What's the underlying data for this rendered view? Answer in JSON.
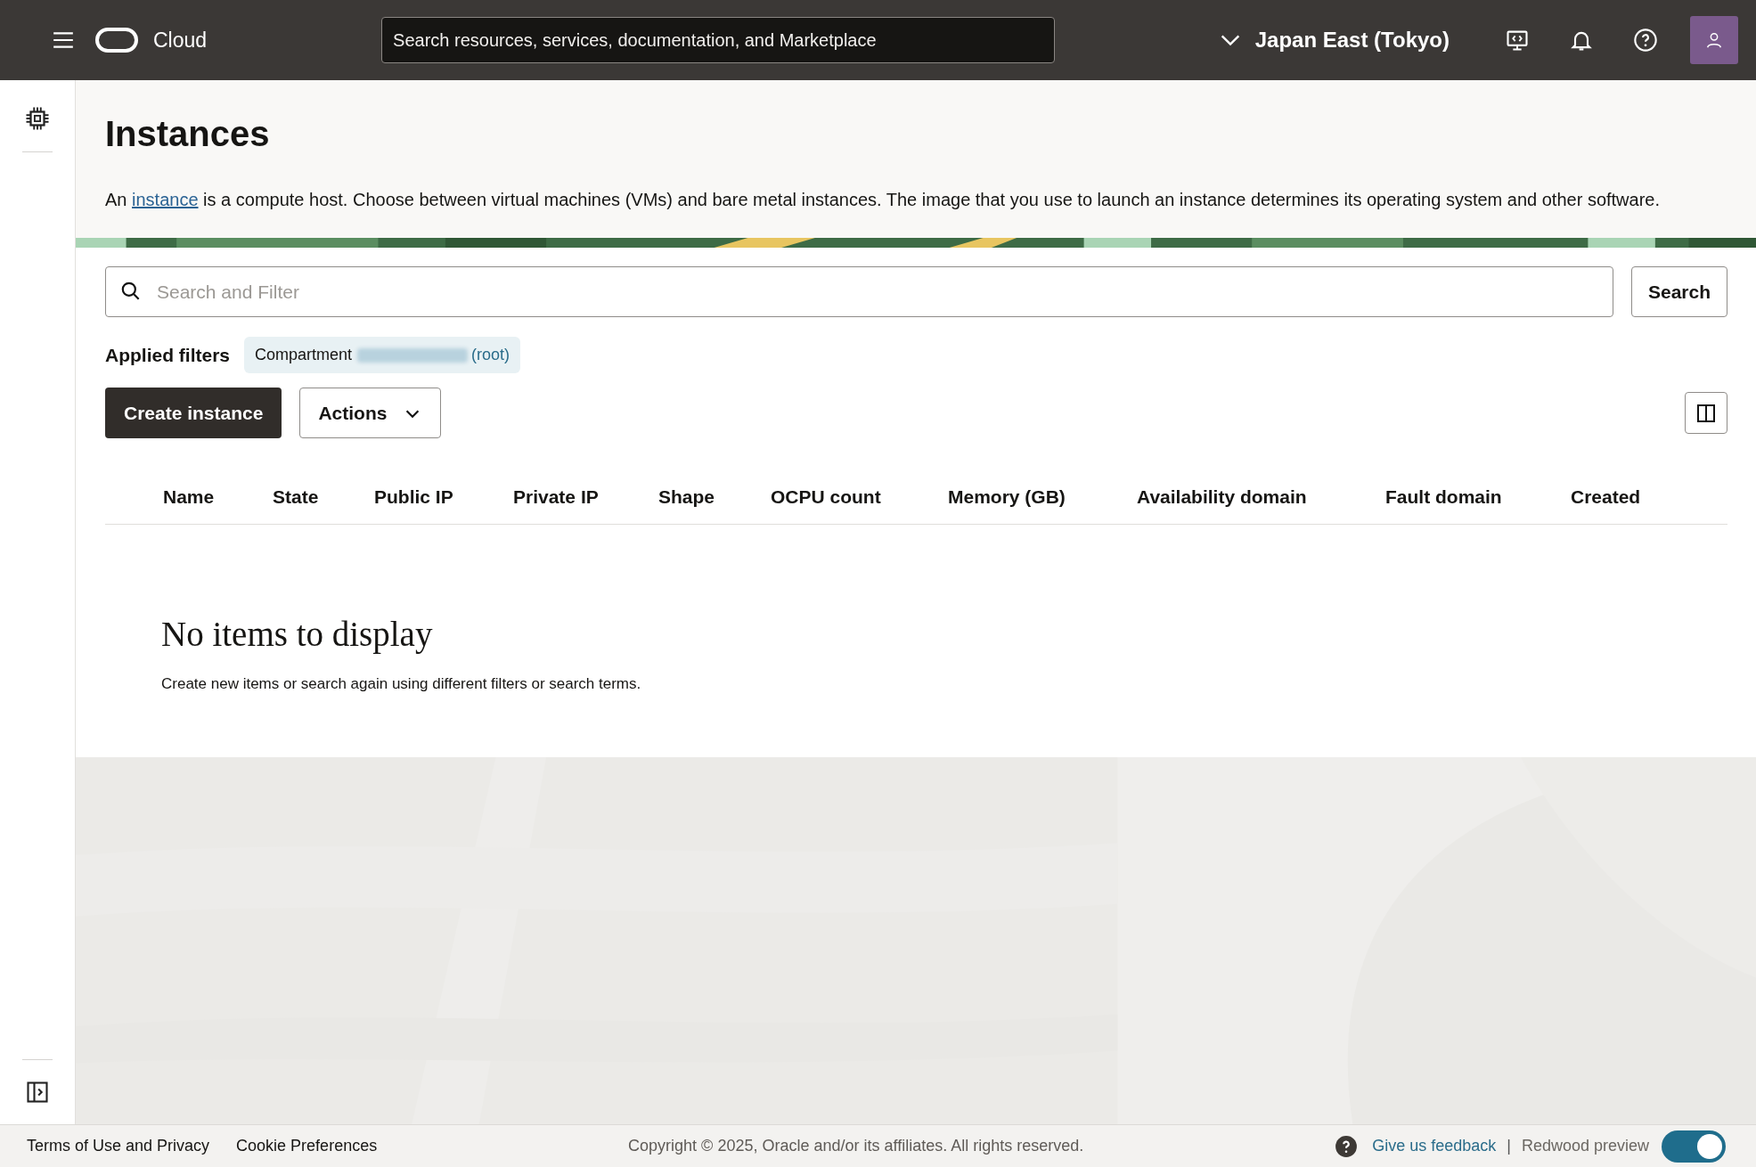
{
  "topbar": {
    "brand": "Cloud",
    "search_placeholder": "Search resources, services, documentation, and Marketplace",
    "region": "Japan East (Tokyo)"
  },
  "page": {
    "title": "Instances",
    "description_before": "An ",
    "description_link": "instance",
    "description_after": " is a compute host. Choose between virtual machines (VMs) and bare metal instances. The image that you use to launch an instance determines its operating system and other software."
  },
  "filter": {
    "placeholder": "Search and Filter",
    "search_button": "Search"
  },
  "applied_filters": {
    "label": "Applied filters",
    "chip_label": "Compartment",
    "chip_value": "(root)"
  },
  "buttons": {
    "create": "Create instance",
    "actions": "Actions"
  },
  "table": {
    "columns": [
      "Name",
      "State",
      "Public IP",
      "Private IP",
      "Shape",
      "OCPU count",
      "Memory (GB)",
      "Availability domain",
      "Fault domain",
      "Created"
    ]
  },
  "empty": {
    "title": "No items to display",
    "text": "Create new items or search again using different filters or search terms."
  },
  "footer": {
    "links": [
      "Terms of Use and Privacy",
      "Cookie Preferences"
    ],
    "copyright": "Copyright © 2025, Oracle and/or its affiliates. All rights reserved.",
    "feedback": "Give us feedback",
    "separator": "|",
    "preview_label": "Redwood preview",
    "preview_on": true
  }
}
